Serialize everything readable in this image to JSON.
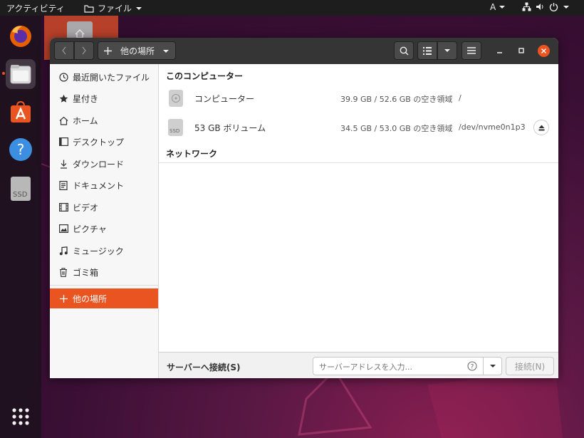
{
  "topbar": {
    "activities": "アクティビティ",
    "app_menu": "ファイル",
    "input_method": "A"
  },
  "dock": {
    "items": [
      "firefox-icon",
      "files-icon",
      "software-icon",
      "help-icon",
      "ssd-drive-icon"
    ],
    "ssd_label": "SSD",
    "show_apps": "grid-icon"
  },
  "window": {
    "path_label": "他の場所",
    "sidebar": [
      {
        "icon": "clock-icon",
        "label": "最近開いたファイル"
      },
      {
        "icon": "star-icon",
        "label": "星付き"
      },
      {
        "icon": "home-icon",
        "label": "ホーム"
      },
      {
        "icon": "desktop-icon",
        "label": "デスクトップ"
      },
      {
        "icon": "download-icon",
        "label": "ダウンロード"
      },
      {
        "icon": "document-icon",
        "label": "ドキュメント"
      },
      {
        "icon": "video-icon",
        "label": "ビデオ"
      },
      {
        "icon": "picture-icon",
        "label": "ピクチャ"
      },
      {
        "icon": "music-icon",
        "label": "ミュージック"
      },
      {
        "icon": "trash-icon",
        "label": "ゴミ箱"
      },
      {
        "icon": "plus-icon",
        "label": "他の場所"
      }
    ],
    "sections": {
      "computer": "このコンピューター",
      "network": "ネットワーク"
    },
    "devices": [
      {
        "name": "コンピューター",
        "space": "39.9 GB / 52.6 GB の空き領域",
        "mount": "/"
      },
      {
        "name": "53 GB ボリューム",
        "space": "34.5 GB / 53.0 GB の空き領域",
        "mount": "/dev/nvme0n1p3"
      }
    ],
    "ssd_small_label": "SSD",
    "bottom": {
      "label": "サーバーへ接続(S)",
      "placeholder": "サーバーアドレスを入力...",
      "connect": "接続(N)"
    }
  },
  "colors": {
    "accent": "#E95420",
    "header": "#353535"
  }
}
